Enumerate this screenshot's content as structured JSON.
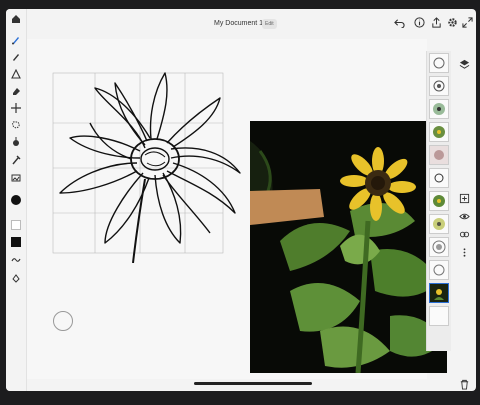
{
  "document": {
    "title": "My Document 10",
    "badge": "Edit"
  },
  "toolbar_left": {
    "tools": [
      "home-icon",
      "brush-icon",
      "pixel-brush-icon",
      "fill-brush-icon",
      "eraser-icon",
      "move-icon",
      "selection-icon",
      "smudge-icon",
      "eyedropper-icon",
      "image-icon"
    ],
    "color": "#111111"
  },
  "toolbar_top_right": [
    "undo-icon",
    "info-icon",
    "share-icon",
    "settings-icon",
    "expand-icon"
  ],
  "layers": {
    "count": 12,
    "selected_index": 10
  },
  "toolbar_right": [
    "layers-icon",
    "add-layer-icon",
    "visibility-icon",
    "link-icon",
    "more-icon",
    "trash-icon"
  ],
  "colors": {
    "accent": "#2a6fd6",
    "canvas": "#f7f7f7",
    "chrome": "#f3f3f3"
  }
}
